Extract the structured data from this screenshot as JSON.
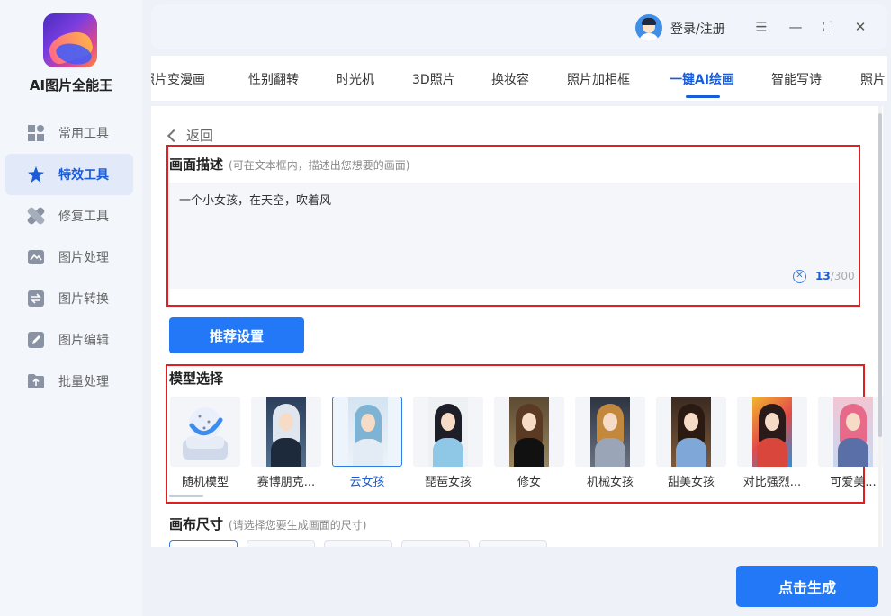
{
  "app": {
    "name": "AI图片全能王"
  },
  "sidebar": {
    "items": [
      {
        "label": "常用工具",
        "icon": "grid-icon"
      },
      {
        "label": "特效工具",
        "icon": "star-icon",
        "active": true
      },
      {
        "label": "修复工具",
        "icon": "bandage-icon"
      },
      {
        "label": "图片处理",
        "icon": "image-icon"
      },
      {
        "label": "图片转换",
        "icon": "convert-icon"
      },
      {
        "label": "图片编辑",
        "icon": "edit-icon"
      },
      {
        "label": "批量处理",
        "icon": "upload-folder-icon"
      }
    ]
  },
  "header": {
    "login_label": "登录/注册",
    "menu_glyph": "☰",
    "minimize_glyph": "—",
    "fullscreen_glyph": "⛶",
    "close_glyph": "✕"
  },
  "tabs": [
    {
      "label": "照片变漫画"
    },
    {
      "label": "性别翻转"
    },
    {
      "label": "时光机"
    },
    {
      "label": "3D照片"
    },
    {
      "label": "换妆容"
    },
    {
      "label": "照片加相框"
    },
    {
      "label": "一键AI绘画",
      "active": true
    },
    {
      "label": "智能写诗"
    },
    {
      "label": "照片"
    }
  ],
  "content": {
    "back_label": "返回",
    "description": {
      "title": "画面描述",
      "hint": "(可在文本框内，描述出您想要的画面)",
      "value": "一个小女孩，在天空，吹着风",
      "count": "13",
      "max": "/300",
      "clear_glyph": "✕"
    },
    "recommend_button": "推荐设置",
    "model": {
      "title": "模型选择",
      "items": [
        {
          "label": "随机模型"
        },
        {
          "label": "赛博朋克..."
        },
        {
          "label": "云女孩",
          "selected": true
        },
        {
          "label": "琵琶女孩"
        },
        {
          "label": "修女"
        },
        {
          "label": "机械女孩"
        },
        {
          "label": "甜美女孩"
        },
        {
          "label": "对比强烈..."
        },
        {
          "label": "可爱美..."
        }
      ]
    },
    "canvas": {
      "title": "画布尺寸",
      "hint": "(请选择您要生成画面的尺寸)"
    }
  },
  "generate_button": "点击生成",
  "colors": {
    "accent": "#2378f7",
    "highlight_border": "#e02020"
  }
}
